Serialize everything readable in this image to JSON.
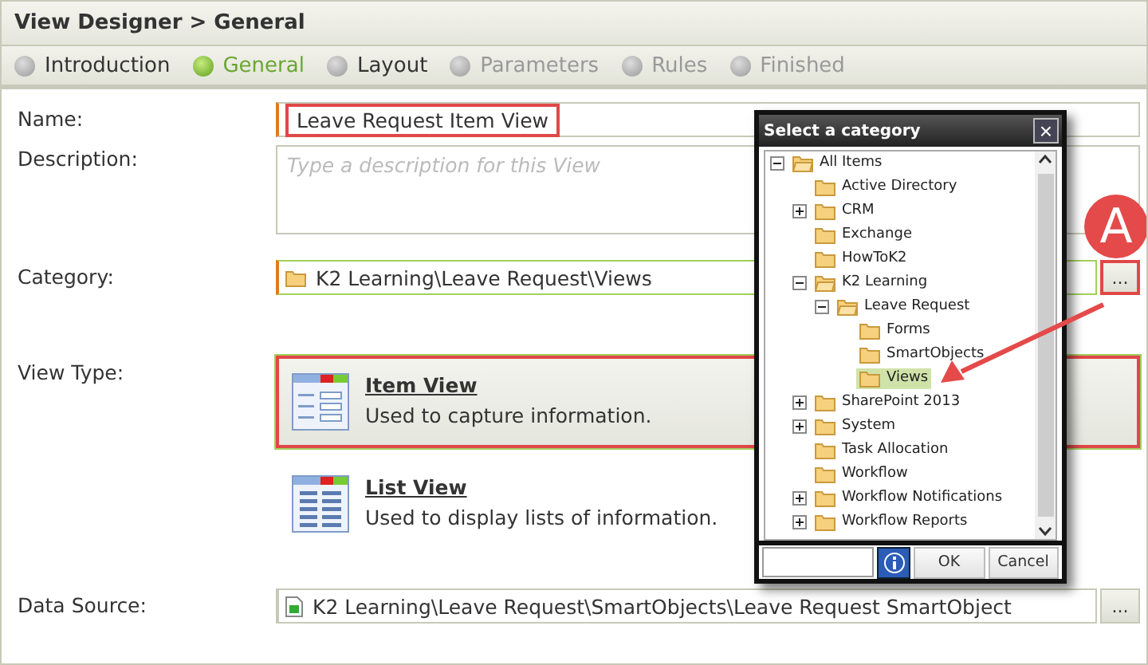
{
  "header": {
    "title": "View Designer > General"
  },
  "steps": [
    {
      "label": "Introduction",
      "selected": false,
      "disabled": false
    },
    {
      "label": "General",
      "selected": true,
      "disabled": false
    },
    {
      "label": "Layout",
      "selected": false,
      "disabled": false
    },
    {
      "label": "Parameters",
      "selected": false,
      "disabled": true
    },
    {
      "label": "Rules",
      "selected": false,
      "disabled": true
    },
    {
      "label": "Finished",
      "selected": false,
      "disabled": true
    }
  ],
  "form": {
    "name": {
      "label": "Name:",
      "value": "Leave Request Item View",
      "highlighted": true
    },
    "description": {
      "label": "Description:",
      "placeholder": "Type a description for this View"
    },
    "category": {
      "label": "Category:",
      "value": "K2 Learning\\Leave Request\\Views",
      "browse": "...",
      "browse_highlighted": true
    },
    "view_type": {
      "label": "View Type:",
      "options": [
        {
          "kind": "item",
          "title": "Item View",
          "description": "Used to capture information.",
          "selected": true,
          "highlighted": true
        },
        {
          "kind": "list",
          "title": "List View",
          "description": "Used to display lists of information.",
          "selected": false,
          "highlighted": false
        }
      ]
    },
    "data_source": {
      "label": "Data Source:",
      "value": "K2 Learning\\Leave Request\\SmartObjects\\Leave Request SmartObject",
      "browse": "..."
    }
  },
  "dialog": {
    "title": "Select a category",
    "close": "×",
    "tree": [
      {
        "label": "All Items",
        "expanded": true,
        "selected": false,
        "children": [
          {
            "label": "Active Directory",
            "selected": false
          },
          {
            "label": "CRM",
            "expanded": false,
            "selected": false
          },
          {
            "label": "Exchange",
            "selected": false
          },
          {
            "label": "HowToK2",
            "selected": false
          },
          {
            "label": "K2 Learning",
            "expanded": true,
            "selected": false,
            "children": [
              {
                "label": "Leave Request",
                "expanded": true,
                "selected": false,
                "children": [
                  {
                    "label": "Forms",
                    "selected": false
                  },
                  {
                    "label": "SmartObjects",
                    "selected": false
                  },
                  {
                    "label": "Views",
                    "selected": true
                  }
                ]
              }
            ]
          },
          {
            "label": "SharePoint 2013",
            "expanded": false,
            "selected": false
          },
          {
            "label": "System",
            "expanded": false,
            "selected": false
          },
          {
            "label": "Task Allocation",
            "selected": false
          },
          {
            "label": "Workflow",
            "selected": false
          },
          {
            "label": "Workflow Notifications",
            "expanded": false,
            "selected": false
          },
          {
            "label": "Workflow Reports",
            "expanded": false,
            "selected": false
          }
        ]
      }
    ],
    "buttons": [
      "OK",
      "Cancel"
    ]
  },
  "callout": {
    "letter": "A"
  }
}
